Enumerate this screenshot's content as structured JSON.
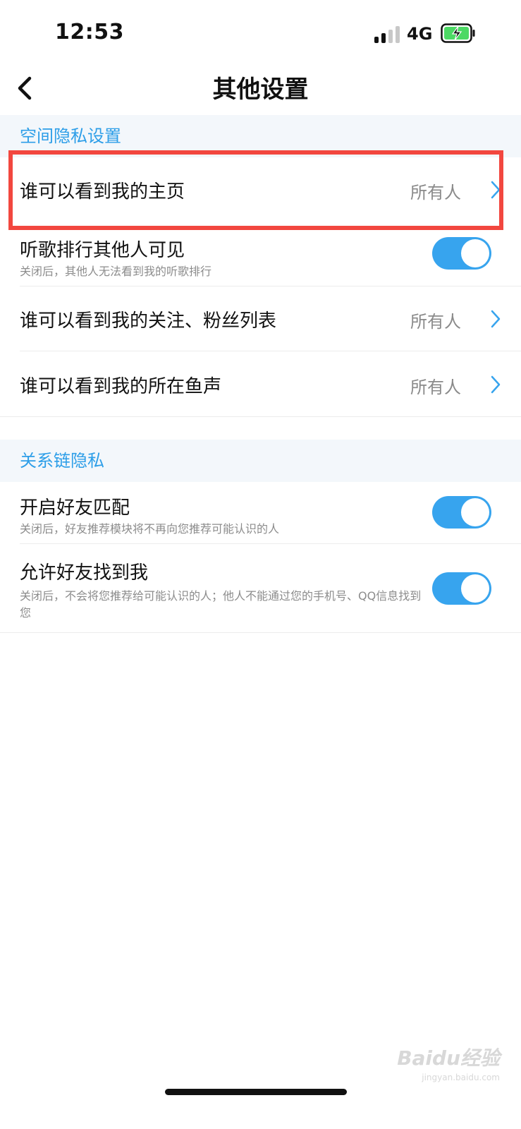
{
  "status_bar": {
    "time": "12:53",
    "network": "4G"
  },
  "nav": {
    "title": "其他设置"
  },
  "sections": [
    {
      "header": "空间隐私设置",
      "rows": [
        {
          "title": "谁可以看到我的主页",
          "value": "所有人"
        },
        {
          "title": "听歌排行其他人可见",
          "subtitle": "关闭后，其他人无法看到我的听歌排行",
          "toggle_on": true
        },
        {
          "title": "谁可以看到我的关注、粉丝列表",
          "value": "所有人"
        },
        {
          "title": "谁可以看到我的所在鱼声",
          "value": "所有人"
        }
      ]
    },
    {
      "header": "关系链隐私",
      "rows": [
        {
          "title": "开启好友匹配",
          "subtitle": "关闭后，好友推荐模块将不再向您推荐可能认识的人",
          "toggle_on": true
        },
        {
          "title": "允许好友找到我",
          "subtitle": "关闭后，不会将您推荐给可能认识的人；他人不能通过您的手机号、QQ信息找到您",
          "toggle_on": true
        }
      ]
    }
  ],
  "watermark": {
    "text": "Baidu经验",
    "sub": "jingyan.baidu.com"
  },
  "colors": {
    "accent": "#37a4ee",
    "section_text": "#2d9ee8",
    "highlight": "#f2473f"
  }
}
